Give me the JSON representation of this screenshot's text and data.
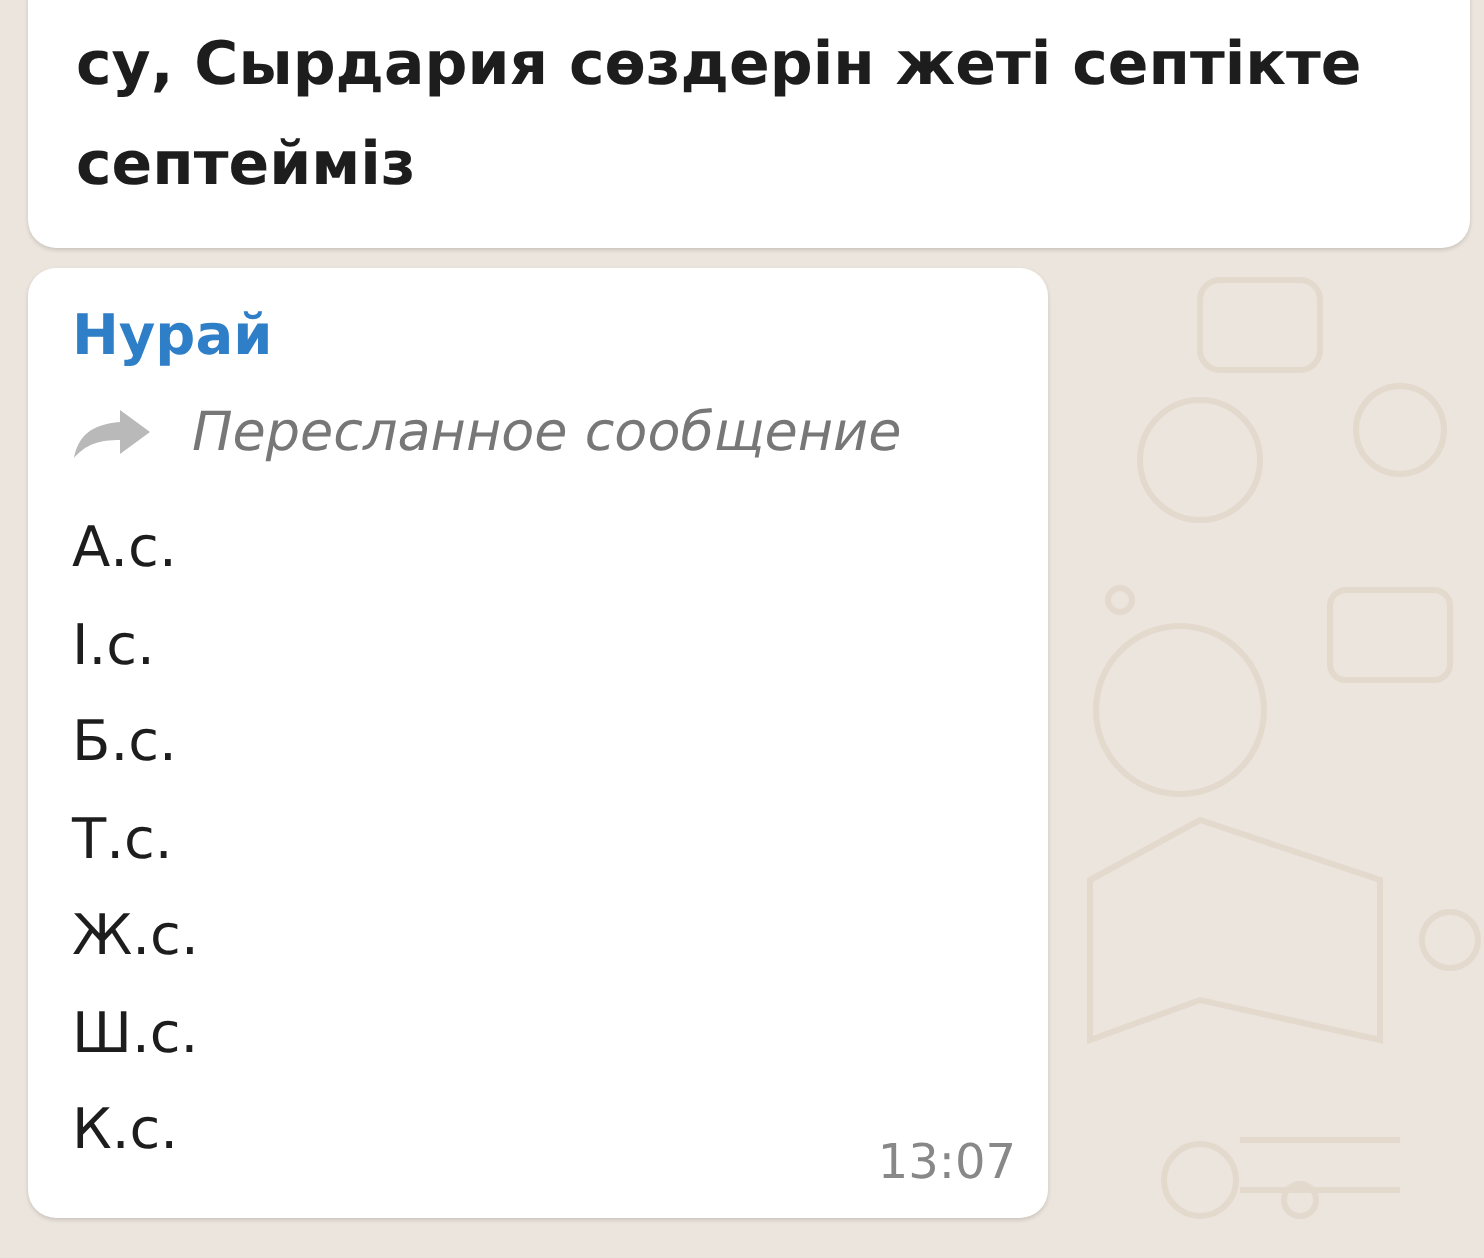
{
  "messages": [
    {
      "kind": "text",
      "text": "су, Сырдария сөздерін жеті септікте септейміз"
    },
    {
      "kind": "forwarded",
      "sender": "Нурай",
      "forward_label": "Пересланное сообщение",
      "lines": [
        "А.с.",
        "І.с.",
        "Б.с.",
        "Т.с.",
        "Ж.с.",
        "Ш.с.",
        "К.с."
      ],
      "time": "13:07"
    }
  ]
}
